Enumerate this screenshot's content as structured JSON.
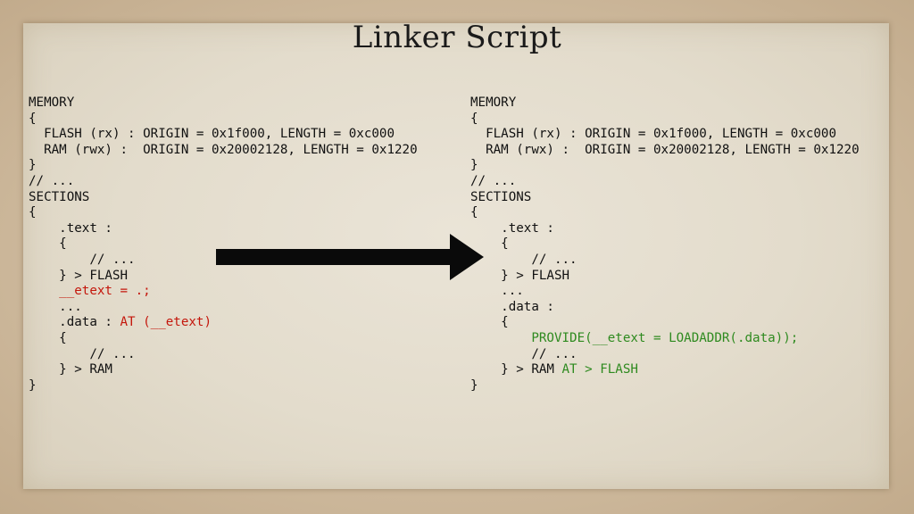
{
  "slide": {
    "title": "Linker Script"
  },
  "left_code": {
    "lines": [
      [
        {
          "t": "MEMORY"
        }
      ],
      [
        {
          "t": "{"
        }
      ],
      [
        {
          "t": "  FLASH (rx) : ORIGIN = 0x1f000, LENGTH = 0xc000"
        }
      ],
      [
        {
          "t": "  RAM (rwx) :  ORIGIN = 0x20002128, LENGTH = 0x1220"
        }
      ],
      [
        {
          "t": "}"
        }
      ],
      [
        {
          "t": "// ..."
        }
      ],
      [
        {
          "t": "SECTIONS"
        }
      ],
      [
        {
          "t": "{"
        }
      ],
      [
        {
          "t": "    .text :"
        }
      ],
      [
        {
          "t": "    {"
        }
      ],
      [
        {
          "t": "        // ..."
        }
      ],
      [
        {
          "t": "    } > FLASH"
        }
      ],
      [
        {
          "t": "    "
        },
        {
          "t": "__etext = .;",
          "c": "red"
        }
      ],
      [
        {
          "t": "    ..."
        }
      ],
      [
        {
          "t": "    .data : "
        },
        {
          "t": "AT (__etext)",
          "c": "red"
        }
      ],
      [
        {
          "t": "    {"
        }
      ],
      [
        {
          "t": "        // ..."
        }
      ],
      [
        {
          "t": "    } > RAM"
        }
      ],
      [
        {
          "t": "}"
        }
      ]
    ]
  },
  "right_code": {
    "lines": [
      [
        {
          "t": "MEMORY"
        }
      ],
      [
        {
          "t": "{"
        }
      ],
      [
        {
          "t": "  FLASH (rx) : ORIGIN = 0x1f000, LENGTH = 0xc000"
        }
      ],
      [
        {
          "t": "  RAM (rwx) :  ORIGIN = 0x20002128, LENGTH = 0x1220"
        }
      ],
      [
        {
          "t": "}"
        }
      ],
      [
        {
          "t": "// ..."
        }
      ],
      [
        {
          "t": "SECTIONS"
        }
      ],
      [
        {
          "t": "{"
        }
      ],
      [
        {
          "t": "    .text :"
        }
      ],
      [
        {
          "t": "    {"
        }
      ],
      [
        {
          "t": "        // ..."
        }
      ],
      [
        {
          "t": "    } > FLASH"
        }
      ],
      [
        {
          "t": "    ..."
        }
      ],
      [
        {
          "t": "    .data :"
        }
      ],
      [
        {
          "t": "    {"
        }
      ],
      [
        {
          "t": "        "
        },
        {
          "t": "PROVIDE(__etext = LOADADDR(.data));",
          "c": "green"
        }
      ],
      [
        {
          "t": "        // ..."
        }
      ],
      [
        {
          "t": "    } > RAM "
        },
        {
          "t": "AT > FLASH",
          "c": "green"
        }
      ],
      [
        {
          "t": "}"
        }
      ]
    ]
  },
  "colors": {
    "highlight_old": "#c4170c",
    "highlight_new": "#2e8a1f"
  },
  "icons": {
    "transition": "right-arrow-icon"
  }
}
